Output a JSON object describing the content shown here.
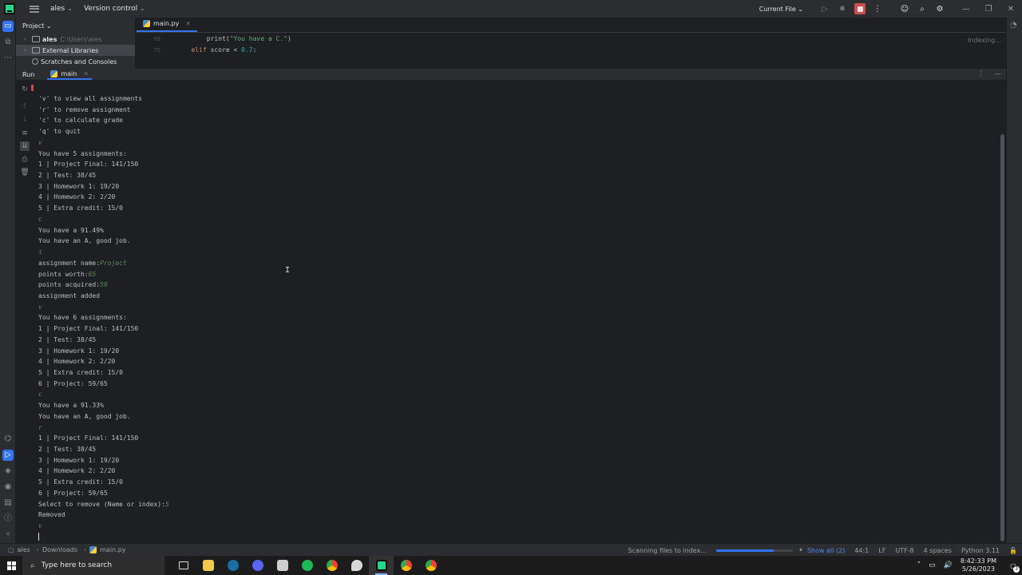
{
  "titlebar": {
    "project_name": "ales",
    "vcs_menu": "Version control",
    "run_config": "Current File"
  },
  "project": {
    "header": "Project",
    "items": [
      {
        "label": "ales",
        "path": "C:\\Users\\ales"
      },
      {
        "label": "External Libraries"
      },
      {
        "label": "Scratches and Consoles"
      }
    ]
  },
  "editor": {
    "tab": "main.py",
    "line_numbers": [
      "69",
      "70"
    ],
    "code_line_1": {
      "indent": "            ",
      "fn": "print(",
      "str": "\"You have a C.\"",
      "end": ")"
    },
    "code_line_2": {
      "indent": "        ",
      "kw": "elif",
      "rest": " score < ",
      "num": "0.7",
      "end": ":"
    },
    "status": "Indexing..."
  },
  "run": {
    "title": "Run",
    "tab": "main"
  },
  "console_lines": [
    {
      "t": "'v' to view all assignments",
      "k": "out"
    },
    {
      "t": "'r' to remove assignment",
      "k": "out"
    },
    {
      "t": "'c' to calculate grade",
      "k": "out"
    },
    {
      "t": "'q' to quit",
      "k": "out"
    },
    {
      "t": "v",
      "k": "inp"
    },
    {
      "t": "You have 5 assignments:",
      "k": "out"
    },
    {
      "t": "1 | Project Final: 141/150",
      "k": "out"
    },
    {
      "t": "2 | Test: 38/45",
      "k": "out"
    },
    {
      "t": "3 | Homework 1: 19/20",
      "k": "out"
    },
    {
      "t": "4 | Homework 2: 2/20",
      "k": "out"
    },
    {
      "t": "5 | Extra credit: 15/0",
      "k": "out"
    },
    {
      "t": "c",
      "k": "inp"
    },
    {
      "t": "You have a 91.49%",
      "k": "out"
    },
    {
      "t": "You have an A, good job.",
      "k": "out"
    },
    {
      "t": "i",
      "k": "inp"
    },
    {
      "t": "assignment name:",
      "k": "out",
      "v": "Project"
    },
    {
      "t": "points worth:",
      "k": "out",
      "v": "65"
    },
    {
      "t": "points acquired:",
      "k": "out",
      "v": "59"
    },
    {
      "t": "assignment added",
      "k": "out"
    },
    {
      "t": "v",
      "k": "inp"
    },
    {
      "t": "You have 6 assignments:",
      "k": "out"
    },
    {
      "t": "1 | Project Final: 141/150",
      "k": "out"
    },
    {
      "t": "2 | Test: 38/45",
      "k": "out"
    },
    {
      "t": "3 | Homework 1: 19/20",
      "k": "out"
    },
    {
      "t": "4 | Homework 2: 2/20",
      "k": "out"
    },
    {
      "t": "5 | Extra credit: 15/0",
      "k": "out"
    },
    {
      "t": "6 | Project: 59/65",
      "k": "out"
    },
    {
      "t": "c",
      "k": "inp"
    },
    {
      "t": "You have a 91.33%",
      "k": "out"
    },
    {
      "t": "You have an A, good job.",
      "k": "out"
    },
    {
      "t": "r",
      "k": "inp"
    },
    {
      "t": "1 | Project Final: 141/150",
      "k": "out"
    },
    {
      "t": "2 | Test: 38/45",
      "k": "out"
    },
    {
      "t": "3 | Homework 1: 19/20",
      "k": "out"
    },
    {
      "t": "4 | Homework 2: 2/20",
      "k": "out"
    },
    {
      "t": "5 | Extra credit: 15/0",
      "k": "out"
    },
    {
      "t": "6 | Project: 59/65",
      "k": "out"
    },
    {
      "t": "Select to remove (Name or index):",
      "k": "out",
      "v": "5"
    },
    {
      "t": "Removed",
      "k": "out"
    },
    {
      "t": "v",
      "k": "inp"
    }
  ],
  "statusbar": {
    "crumbs": [
      "ales",
      "Downloads",
      "main.py"
    ],
    "task": "Scanning files to index...",
    "progress": 0.75,
    "show_all": "Show all (2)",
    "position": "44:1",
    "line_sep": "LF",
    "encoding": "UTF-8",
    "indent": "4 spaces",
    "interpreter": "Python 3.11"
  },
  "taskbar": {
    "search_placeholder": "Type here to search",
    "time": "8:42:33 PM",
    "date": "5/26/2023",
    "notification_count": "3"
  },
  "colors": {
    "accent": "#3574f0",
    "background": "#1e1f22",
    "panel": "#2b2d30",
    "stop": "#c94f4f"
  }
}
